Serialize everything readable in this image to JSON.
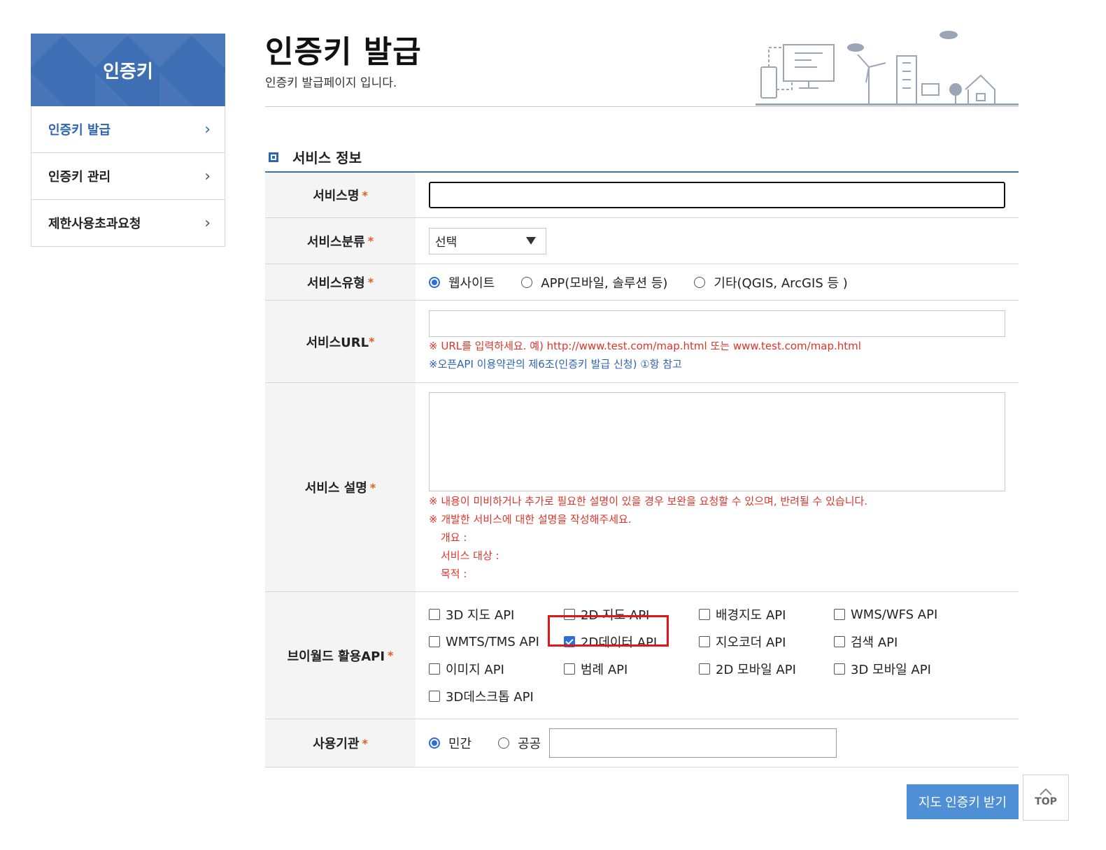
{
  "sidebar": {
    "title": "인증키",
    "items": [
      {
        "label": "인증키 발급",
        "active": true
      },
      {
        "label": "인증키 관리",
        "active": false
      },
      {
        "label": "제한사용초과요청",
        "active": false
      }
    ]
  },
  "header": {
    "title": "인증키 발급",
    "subtitle": "인증키 발급페이지 입니다."
  },
  "section": {
    "title": "서비스 정보"
  },
  "form": {
    "service_name": {
      "label": "서비스명",
      "required_mark": "*",
      "value": ""
    },
    "service_category": {
      "label": "서비스분류",
      "required_mark": "*",
      "selected": "선택"
    },
    "service_type": {
      "label": "서비스유형",
      "required_mark": "*",
      "options": [
        "웹사이트",
        "APP(모바일, 솔루션 등)",
        "기타(QGIS, ArcGIS 등 )"
      ],
      "selected_index": 0
    },
    "service_url": {
      "label": "서비스URL",
      "required_mark": "*",
      "value": "",
      "note1": "※ URL를 입력하세요. 예) http://www.test.com/map.html 또는 www.test.com/map.html",
      "note2": "※오픈API 이용약관의 제6조(인증키 발급 신청) ①항 참고"
    },
    "service_desc": {
      "label": "서비스 설명",
      "required_mark": "*",
      "value": "",
      "note1": "※ 내용이 미비하거나 추가로 필요한 설명이 있을 경우 보완을 요청할 수 있으며, 반려될 수 있습니다.",
      "note2": "※ 개발한 서비스에 대한 설명을 작성해주세요.",
      "note3": "개요 :",
      "note4": "서비스 대상 :",
      "note5": "목적 :"
    },
    "vworld_api": {
      "label": "브이월드 활용API",
      "required_mark": "*",
      "options": [
        {
          "label": "3D 지도 API",
          "checked": false
        },
        {
          "label": "2D 지도 API",
          "checked": false
        },
        {
          "label": "배경지도 API",
          "checked": false
        },
        {
          "label": "WMS/WFS API",
          "checked": false
        },
        {
          "label": "WMTS/TMS API",
          "checked": false
        },
        {
          "label": "2D데이터 API",
          "checked": true
        },
        {
          "label": "지오코더 API",
          "checked": false
        },
        {
          "label": "검색 API",
          "checked": false
        },
        {
          "label": "이미지 API",
          "checked": false
        },
        {
          "label": "범례 API",
          "checked": false
        },
        {
          "label": "2D 모바일 API",
          "checked": false
        },
        {
          "label": "3D 모바일 API",
          "checked": false
        },
        {
          "label": "3D데스크톱 API",
          "checked": false
        }
      ]
    },
    "org_type": {
      "label": "사용기관",
      "required_mark": "*",
      "options": [
        "민간",
        "공공"
      ],
      "selected_index": 0,
      "value": ""
    }
  },
  "buttons": {
    "submit": "지도 인증키 받기",
    "top": "TOP"
  },
  "colors": {
    "primary": "#3e6fb4",
    "accent_button": "#4f8fd6",
    "required": "#e85b1a",
    "note_red": "#e0342a",
    "highlight_box": "#e4141b"
  }
}
